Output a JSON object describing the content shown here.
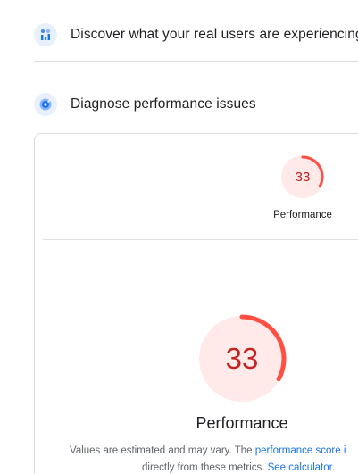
{
  "sections": {
    "field_data": {
      "title": "Discover what your real users are experiencing",
      "icon": "users-chart-icon"
    },
    "lab_data": {
      "title": "Diagnose performance issues",
      "icon": "lighthouse-icon"
    }
  },
  "summary_gauge": {
    "score": "33",
    "label": "Performance",
    "score_fraction": 0.33,
    "color": "#ff4e42"
  },
  "main_gauge": {
    "score": "33",
    "label": "Performance",
    "score_fraction": 0.33,
    "color": "#ff4e42",
    "background": "#ffe9e9"
  },
  "note": {
    "prefix": "Values are estimated and may vary. The ",
    "score_link": "performance score i",
    "line2_prefix": "directly from these metrics. ",
    "calculator_link": "See calculator",
    "line2_suffix": "."
  }
}
